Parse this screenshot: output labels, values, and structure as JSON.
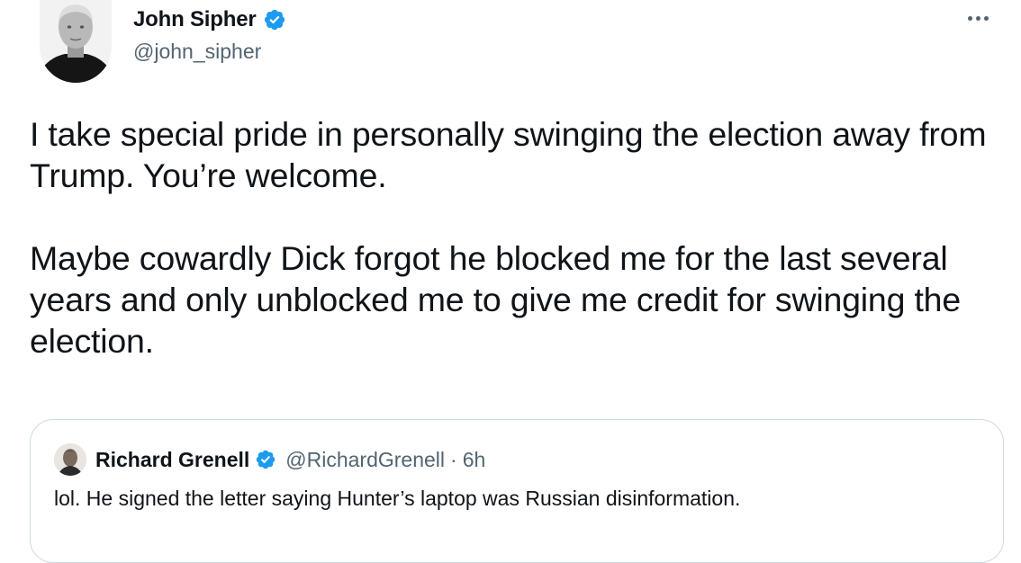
{
  "tweet": {
    "author": {
      "display_name": "John Sipher",
      "handle": "@john_sipher",
      "verified": true
    },
    "paragraphs": [
      "I take special pride in personally swinging the election away from Trump. You’re welcome.",
      "Maybe cowardly Dick forgot he blocked me for the last several years and only unblocked me to give me credit for swinging the election."
    ],
    "more_icon": "ellipsis-icon"
  },
  "quote": {
    "author": {
      "display_name": "Richard Grenell",
      "handle": "@RichardGrenell",
      "verified": true
    },
    "separator": "·",
    "time": "6h",
    "text": "lol. He signed the letter saying Hunter’s laptop was Russian disinformation."
  },
  "colors": {
    "text_primary": "#0f1419",
    "text_secondary": "#536471",
    "verified_blue": "#1d9bf0",
    "border": "#cfd9de"
  }
}
